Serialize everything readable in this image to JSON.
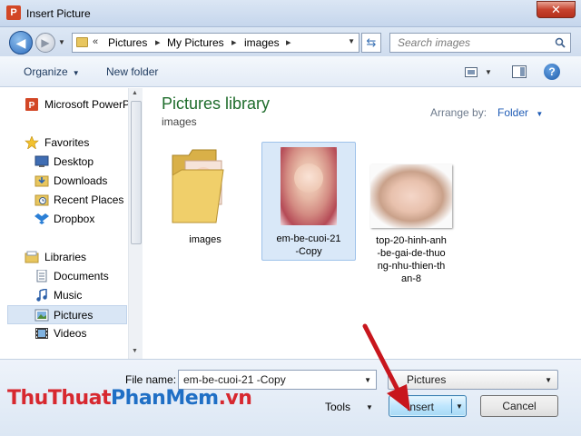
{
  "window": {
    "title": "Insert Picture",
    "close_label": "✕"
  },
  "address": {
    "crumbs": [
      "Pictures",
      "My Pictures",
      "images"
    ],
    "search_placeholder": "Search images"
  },
  "toolbar": {
    "organize_label": "Organize",
    "new_folder_label": "New folder",
    "help_label": "?"
  },
  "sidebar": {
    "top_item": "Microsoft PowerP",
    "favorites_header": "Favorites",
    "favorites": [
      "Desktop",
      "Downloads",
      "Recent Places",
      "Dropbox"
    ],
    "libraries_header": "Libraries",
    "libraries": [
      "Documents",
      "Music",
      "Pictures",
      "Videos"
    ],
    "selected": "Pictures"
  },
  "main": {
    "library_title": "Pictures library",
    "library_sub": "images",
    "arrange_label": "Arrange by:",
    "arrange_value": "Folder",
    "items": [
      {
        "label": "images",
        "type": "folder"
      },
      {
        "label": "em-be-cuoi-21 -Copy",
        "type": "image",
        "selected": true
      },
      {
        "label": "top-20-hinh-anh -be-gai-de-thuo ng-nhu-thien-th an-8",
        "type": "image"
      }
    ],
    "item_label_lines": {
      "item1": [
        "em-be-cuoi-21",
        "-Copy"
      ],
      "item2": [
        "top-20-hinh-anh",
        "-be-gai-de-thuo",
        "ng-nhu-thien-th",
        "an-8"
      ]
    }
  },
  "bottom": {
    "file_name_label": "File name:",
    "file_name_value": "em-be-cuoi-21 -Copy",
    "file_type_value": "Pictures",
    "tools_label": "Tools",
    "insert_label": "Insert",
    "cancel_label": "Cancel"
  },
  "watermark": {
    "part1": "ThuThuat",
    "part2": "PhanMem",
    "part3": ".vn"
  },
  "colors": {
    "library_title": "#1e6c2b",
    "link_blue": "#1e5bb5",
    "annotation_red": "#c8161d"
  }
}
